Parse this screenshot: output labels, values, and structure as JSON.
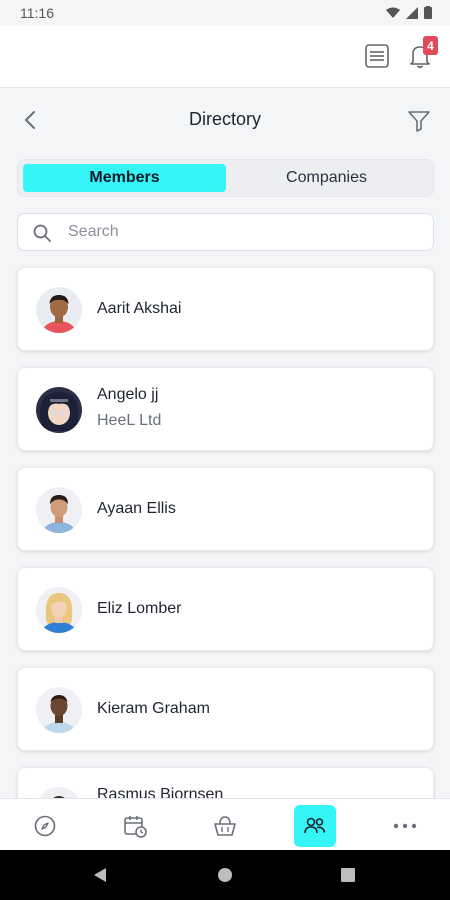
{
  "status_bar": {
    "time": "11:16"
  },
  "topbar": {
    "notification_count": "4"
  },
  "header": {
    "title": "Directory"
  },
  "tabs": [
    {
      "label": "Members",
      "active": true
    },
    {
      "label": "Companies",
      "active": false
    }
  ],
  "search": {
    "placeholder": "Search",
    "value": ""
  },
  "members": [
    {
      "name": "Aarit Akshai",
      "company": ""
    },
    {
      "name": "Angelo jj",
      "company": "HeeL Ltd"
    },
    {
      "name": "Ayaan Ellis",
      "company": ""
    },
    {
      "name": "Eliz Lomber",
      "company": ""
    },
    {
      "name": "Kieram Graham",
      "company": ""
    },
    {
      "name": "Rasmus Bjornsen",
      "company": ""
    }
  ],
  "bottom_nav": [
    {
      "icon": "compass-icon",
      "active": false
    },
    {
      "icon": "calendar-clock-icon",
      "active": false
    },
    {
      "icon": "basket-icon",
      "active": false
    },
    {
      "icon": "people-icon",
      "active": true
    },
    {
      "icon": "more-icon",
      "active": false
    }
  ],
  "colors": {
    "accent": "#36f5f7",
    "badge": "#e24a5a",
    "background": "#f4f5f7"
  }
}
